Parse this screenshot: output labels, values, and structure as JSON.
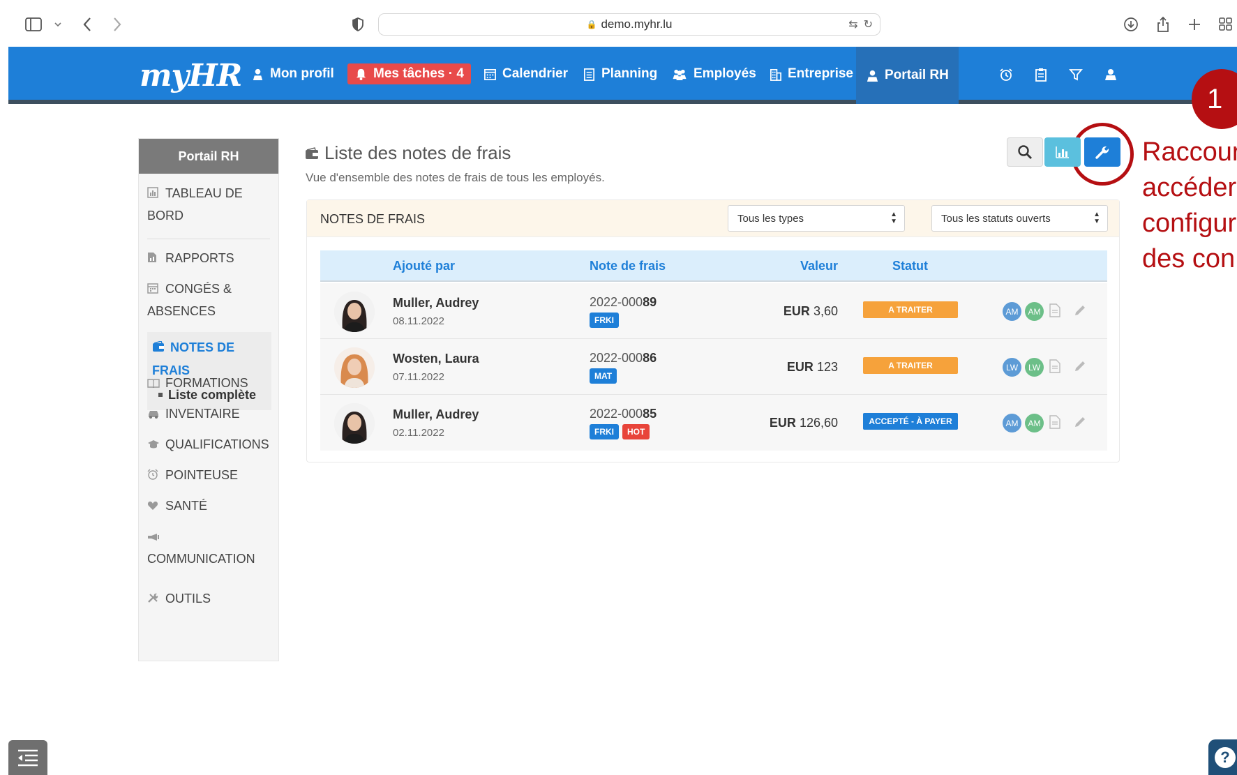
{
  "browser": {
    "url": "demo.myhr.lu"
  },
  "nav": {
    "logo": "myHR",
    "items": {
      "profil": "Mon profil",
      "taches": "Mes tâches · 4",
      "calendrier": "Calendrier",
      "planning": "Planning",
      "employes": "Employés",
      "entreprise": "Entreprise",
      "portail": "Portail RH"
    }
  },
  "annotation": {
    "number": "1",
    "lines": [
      "Raccour",
      "accéder",
      "configur",
      "des con"
    ]
  },
  "sidebar": {
    "title": "Portail RH",
    "items": {
      "tableau": "TABLEAU DE BORD",
      "rapports": "RAPPORTS",
      "conges": "CONGÉS & ABSENCES",
      "notes": "NOTES DE FRAIS",
      "notes_sub": "Liste complète",
      "formations": "FORMATIONS",
      "inventaire": "INVENTAIRE",
      "qualifications": "QUALIFICATIONS",
      "pointeuse": "POINTEUSE",
      "sante": "SANTÉ",
      "communication": "COMMUNICATION",
      "outils": "OUTILS"
    }
  },
  "page": {
    "title": "Liste des notes de frais",
    "subtitle": "Vue d'ensemble des notes de frais de tous les employés."
  },
  "panel": {
    "title": "NOTES DE FRAIS",
    "filter_type": "Tous les types",
    "filter_status": "Tous les statuts ouverts"
  },
  "table": {
    "headers": {
      "added_by": "Ajouté par",
      "note": "Note de frais",
      "value": "Valeur",
      "status": "Statut"
    },
    "rows": [
      {
        "name": "Muller, Audrey",
        "date": "08.11.2022",
        "note_prefix": "2022-000",
        "note_suffix": "89",
        "tags": [
          "FRKI"
        ],
        "currency": "EUR",
        "amount": "3,60",
        "status": "A TRAITER",
        "initials": "AM"
      },
      {
        "name": "Wosten, Laura",
        "date": "07.11.2022",
        "note_prefix": "2022-000",
        "note_suffix": "86",
        "tags": [
          "MAT"
        ],
        "currency": "EUR",
        "amount": "123",
        "status": "A TRAITER",
        "initials": "LW"
      },
      {
        "name": "Muller, Audrey",
        "date": "02.11.2022",
        "note_prefix": "2022-000",
        "note_suffix": "85",
        "tags": [
          "FRKI",
          "HOT"
        ],
        "currency": "EUR",
        "amount": "126,60",
        "status": "ACCEPTÉ - À PAYER",
        "initials": "AM"
      }
    ]
  },
  "colors": {
    "nav": "#1e7fd8",
    "tasks": "#e84a4a",
    "annotation": "#b50f12",
    "status_traiter": "#f6a23b",
    "status_payer": "#1e7fd8",
    "tag_blue": "#1e7fd8",
    "tag_red": "#e8443a"
  }
}
